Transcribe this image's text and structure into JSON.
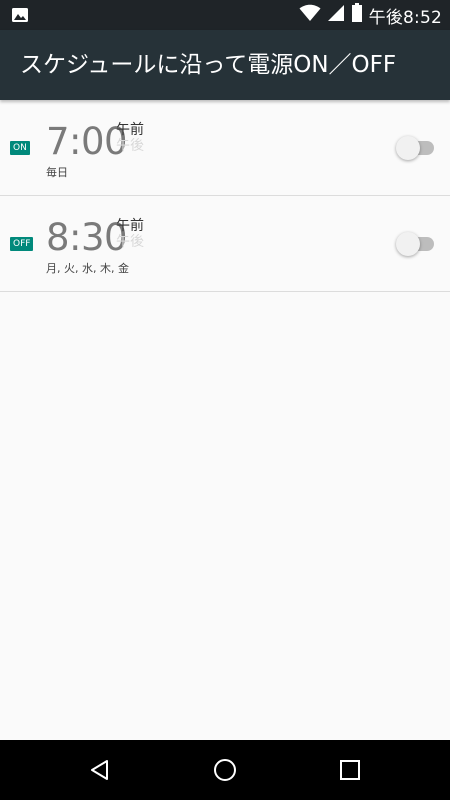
{
  "status_bar": {
    "time": "午後8:52",
    "icons": [
      "image-icon",
      "wifi-icon",
      "signal-icon",
      "battery-icon"
    ]
  },
  "app_bar": {
    "title": "スケジュールに沿って電源ON／OFF"
  },
  "schedules": [
    {
      "badge": "ON",
      "time": "7:00",
      "am": "午前",
      "pm": "午後",
      "days": "毎日",
      "enabled": false
    },
    {
      "badge": "OFF",
      "time": "8:30",
      "am": "午前",
      "pm": "午後",
      "days": "月, 火, 水, 木, 金",
      "enabled": false
    }
  ],
  "nav_bar": {
    "icons": [
      "back-icon",
      "home-icon",
      "recents-icon"
    ]
  },
  "colors": {
    "app_bar": "#263238",
    "status_bar": "#1f2428",
    "badge": "#00897b",
    "background": "#fafafa"
  }
}
